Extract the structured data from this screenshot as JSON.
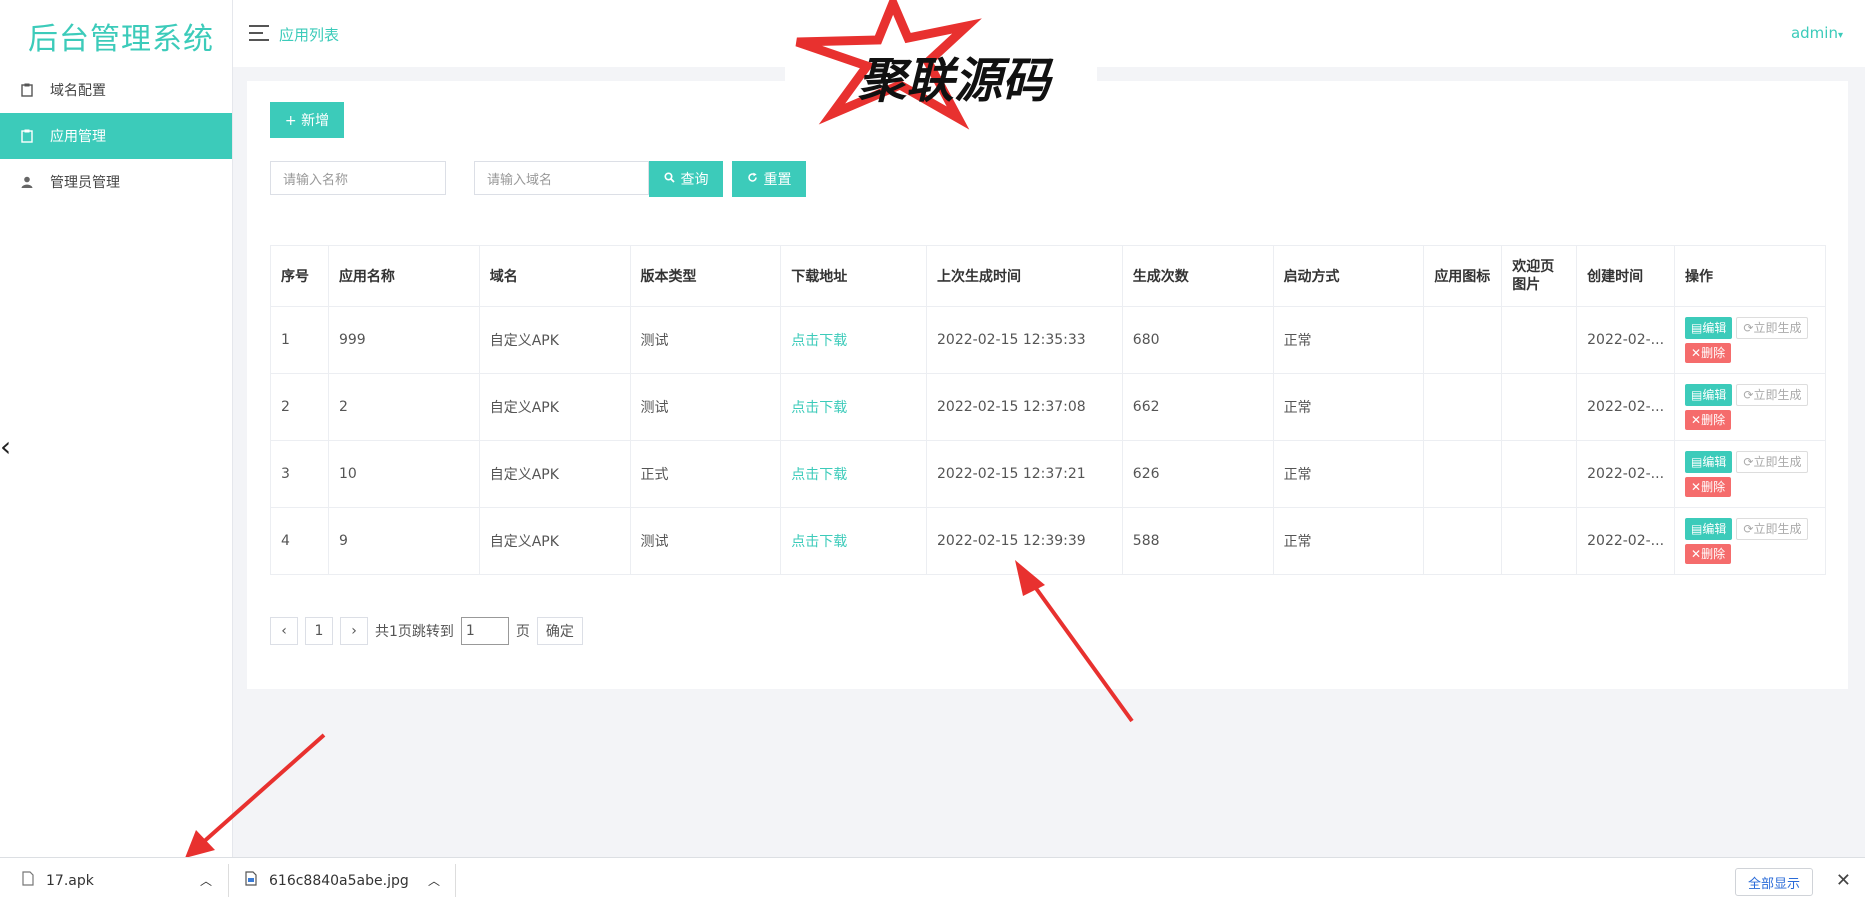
{
  "app": {
    "title": "后台管理系统",
    "breadcrumb": "应用列表",
    "user": "admin"
  },
  "sidebar": {
    "items": [
      {
        "label": "域名配置",
        "icon": "clipboard-icon"
      },
      {
        "label": "应用管理",
        "icon": "clipboard-icon",
        "active": true
      },
      {
        "label": "管理员管理",
        "icon": "user-icon"
      }
    ]
  },
  "watermark": {
    "text": "聚联源码"
  },
  "toolbar": {
    "add_label": "+ 新增"
  },
  "search": {
    "name_placeholder": "请输入名称",
    "domain_placeholder": "请输入域名",
    "query_label": "查询",
    "reset_label": "重置"
  },
  "table": {
    "headers": [
      "序号",
      "应用名称",
      "域名",
      "版本类型",
      "下载地址",
      "上次生成时间",
      "生成次数",
      "启动方式",
      "应用图标",
      "欢迎页图片",
      "创建时间",
      "操作"
    ],
    "rows": [
      [
        "1",
        "999",
        "自定义APK",
        "测试",
        "点击下载",
        "2022-02-15 12:35:33",
        "680",
        "正常",
        "",
        "",
        "2022-02-..."
      ],
      [
        "2",
        "2",
        "自定义APK",
        "测试",
        "点击下载",
        "2022-02-15 12:37:08",
        "662",
        "正常",
        "",
        "",
        "2022-02-..."
      ],
      [
        "3",
        "10",
        "自定义APK",
        "正式",
        "点击下载",
        "2022-02-15 12:37:21",
        "626",
        "正常",
        "",
        "",
        "2022-02-..."
      ],
      [
        "4",
        "9",
        "自定义APK",
        "测试",
        "点击下载",
        "2022-02-15 12:39:39",
        "588",
        "正常",
        "",
        "",
        "2022-02-..."
      ]
    ],
    "actions": {
      "edit": "编辑",
      "generate": "立即生成",
      "delete": "删除"
    }
  },
  "pagination": {
    "prev": "‹",
    "page": "1",
    "next": "›",
    "total_text": "共1页跳转到",
    "jump_value": "1",
    "page_suffix": "页",
    "confirm": "确定"
  },
  "downloads": {
    "items": [
      {
        "name": "17.apk"
      },
      {
        "name": "616c8840a5abe.jpg"
      }
    ],
    "show_all": "全部显示",
    "close": "✕"
  },
  "colors": {
    "accent": "#3ccbba",
    "danger": "#f56c6c",
    "annotation": "#e8312f"
  }
}
